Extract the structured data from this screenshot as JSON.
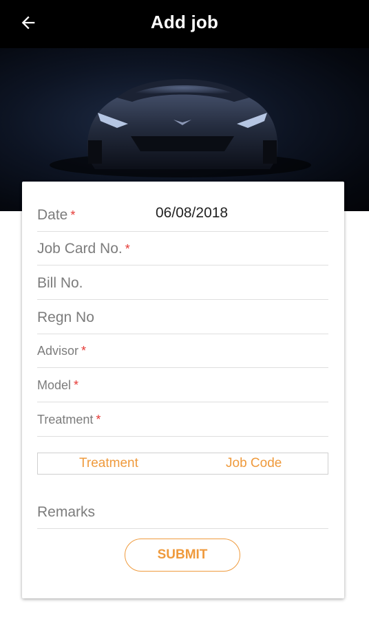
{
  "appbar": {
    "title": "Add job",
    "back_icon": "arrow-left-icon"
  },
  "hero": {
    "image": "sports-car-photo"
  },
  "form": {
    "fields": [
      {
        "label": "Date",
        "required": "*",
        "value": "06/08/2018"
      },
      {
        "label": "Job Card No.",
        "required": "*",
        "value": ""
      },
      {
        "label": "Bill No.",
        "required": "",
        "value": ""
      },
      {
        "label": "Regn No",
        "required": "",
        "value": ""
      },
      {
        "label": "Advisor",
        "required": "*",
        "value": ""
      },
      {
        "label": "Model",
        "required": "*",
        "value": ""
      },
      {
        "label": "Treatment",
        "required": "*",
        "value": ""
      }
    ],
    "toggle": {
      "option1": "Treatment",
      "option2": "Job Code"
    },
    "remarks": {
      "label": "Remarks",
      "value": ""
    },
    "submit_label": "SUBMIT"
  },
  "colors": {
    "accent": "#ef9a3c",
    "required": "#e53935",
    "appbar": "#000000"
  }
}
